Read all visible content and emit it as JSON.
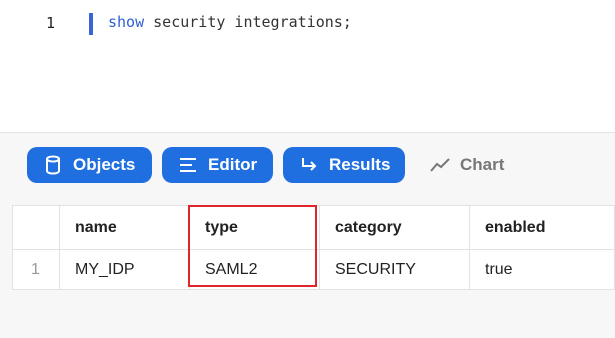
{
  "editor": {
    "line_number": "1",
    "code_keyword": "show",
    "code_rest": " security integrations;"
  },
  "toolbar": {
    "objects_label": "Objects",
    "editor_label": "Editor",
    "results_label": "Results",
    "chart_label": "Chart"
  },
  "table": {
    "columns": [
      "name",
      "type",
      "category",
      "enabled"
    ],
    "rows": [
      {
        "num": "1",
        "cells": [
          "MY_IDP",
          "SAML2",
          "SECURITY",
          "true"
        ]
      }
    ]
  },
  "colors": {
    "accent": "#1f6fe0",
    "keyword": "#2f5fd0",
    "highlight": "#e0262b"
  }
}
